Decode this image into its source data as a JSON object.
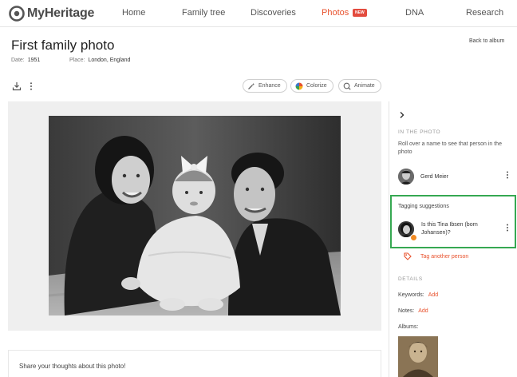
{
  "brand": {
    "name": "MyHeritage",
    "accent": "#e8512c"
  },
  "nav": {
    "items": [
      {
        "label": "Home"
      },
      {
        "label": "Family tree"
      },
      {
        "label": "Discoveries"
      },
      {
        "label": "Photos",
        "active": true,
        "badge": "NEW"
      },
      {
        "label": "DNA"
      },
      {
        "label": "Research"
      }
    ]
  },
  "page": {
    "title": "First family photo",
    "back_label": "Back to album",
    "date_label": "Date:",
    "date_value": "1951",
    "place_label": "Place:",
    "place_value": "London, England"
  },
  "toolbar": {
    "download_icon": "download-icon",
    "more_icon": "more-vertical-icon",
    "enhance_label": "Enhance",
    "colorize_label": "Colorize",
    "animate_label": "Animate"
  },
  "comment": {
    "placeholder": "Share your thoughts about this photo!"
  },
  "sidebar": {
    "collapse_icon": "chevron-right-icon",
    "in_photo_heading": "IN THE PHOTO",
    "in_photo_hint": "Roll over a name to see that person in the photo",
    "people": [
      {
        "name": "Gerd Meier"
      }
    ],
    "tagging_title": "Tagging suggestions",
    "suggestion_text": "Is this Tina Ibsen (born Johansen)?",
    "tag_another_label": "Tag another person",
    "details_heading": "DETAILS",
    "keywords_label": "Keywords:",
    "notes_label": "Notes:",
    "add_label": "Add",
    "albums_label": "Albums:",
    "highlight_color": "#36a852"
  }
}
